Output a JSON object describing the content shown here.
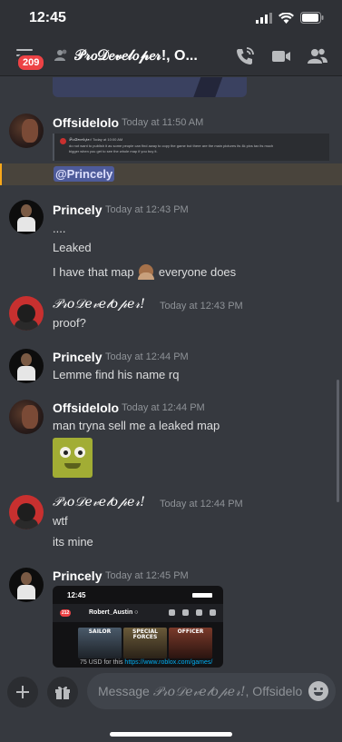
{
  "status_bar": {
    "time": "12:45"
  },
  "header": {
    "unread_badge": "209",
    "title": "𝒫𝓇𝑜𝒟𝑒𝓋𝑒𝓁𝑜𝓅𝑒𝓇!, O...",
    "icons": [
      "hamburger-icon",
      "dm-group-icon",
      "phone-icon",
      "video-icon",
      "members-icon"
    ]
  },
  "messages": [
    {
      "author": "Offsidelolo",
      "timestamp": "Today at 11:50 AM",
      "attachment_preview": {
        "header": "𝒫𝓇𝑜𝒟𝑒𝓋𝑒𝓁𝑜𝓅𝑒𝓇!  Today at 10:00 AM",
        "lines": [
          "do not want to publish it as some people can find away to copy the game but there are the main pictures its 4k pixs tax its much",
          "bigger when you get to see the whole map if you buy it."
        ]
      }
    },
    {
      "mention": "@Princely"
    },
    {
      "author": "Princely",
      "timestamp": "Today at 12:43 PM",
      "lines": [
        "....",
        "Leaked",
        "I have that map",
        "everyone does"
      ]
    },
    {
      "author": "𝒫𝓇𝑜𝒟𝑒𝓋𝑒𝓁𝑜𝓅𝑒𝓇!",
      "timestamp": "Today at 12:43 PM",
      "lines": [
        "proof?"
      ]
    },
    {
      "author": "Princely",
      "timestamp": "Today at 12:44 PM",
      "lines": [
        "Lemme find his name rq"
      ]
    },
    {
      "author": "Offsidelolo",
      "timestamp": "Today at 12:44 PM",
      "lines": [
        "man tryna sell me a leaked map"
      ]
    },
    {
      "author": "𝒫𝓇𝑜𝒟𝑒𝓋𝑒𝓁𝑜𝓅𝑒𝓇!",
      "timestamp": "Today at 12:44 PM",
      "lines": [
        "wtf",
        "its mine"
      ]
    },
    {
      "author": "Princely",
      "timestamp": "Today at 12:45 PM",
      "embed": {
        "time": "12:45",
        "badge": "212",
        "name": "Robert_Austin ○",
        "cards": [
          "SAILOR",
          "SPECIAL FORCES",
          "OFFICER"
        ],
        "caption_prefix": "75 USD for this ",
        "caption_link": "https://www.roblox.com/games/"
      }
    }
  ],
  "composer": {
    "placeholder_prefix": "Message ",
    "placeholder_script": "𝒫𝓇𝑜𝒟𝑒𝓋𝑒𝓁𝑜𝓅𝑒𝓇!",
    "placeholder_suffix": ", Offsidelolo"
  }
}
